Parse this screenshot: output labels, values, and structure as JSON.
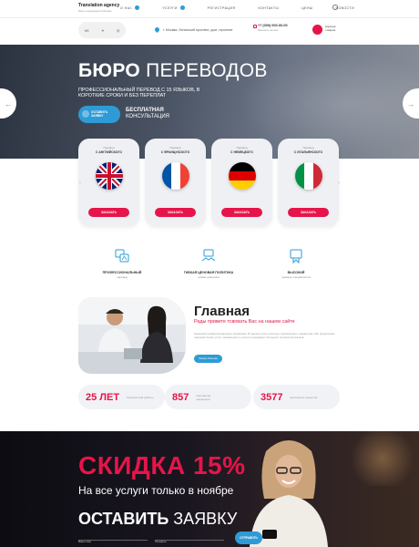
{
  "header": {
    "brand_name": "Translation agency",
    "brand_tagline": "Бюро переводов в Москве",
    "nav": [
      {
        "label": "О НАС",
        "has_dropdown": true
      },
      {
        "label": "УСЛУГИ",
        "has_dropdown": true
      },
      {
        "label": "РЕГИСТРАЦИЯ",
        "has_dropdown": false
      },
      {
        "label": "КОНТАКТЫ",
        "has_dropdown": false
      },
      {
        "label": "ЦЕНЫ",
        "has_dropdown": false
      },
      {
        "label": "НОВОСТИ",
        "has_dropdown": false
      }
    ]
  },
  "contacts": {
    "socials": [
      "vk-icon",
      "telegram-icon",
      "instagram-icon"
    ],
    "social_glyphs": [
      "VK",
      "✈",
      "◎"
    ],
    "address": "г. Москва, Ленинский проспект, дом, строение",
    "phone": "+7 (000) 000-00-00",
    "phone_sub": "Заказать звонок",
    "cart_label": "Корзина товаров"
  },
  "hero": {
    "title_bold": "БЮРО",
    "title_rest": "ПЕРЕВОДОВ",
    "subtitle": "ПРОФЕССИОНАЛЬНЫЙ ПЕРЕВОД С 15 ЯЗЫКОВ, В КОРОТКИЕ СРОКИ И БЕЗ ПЕРЕПЛАТ",
    "button_label": "ОСТАВИТЬ ЗАЯВКУ",
    "free_title": "БЕСПЛАТНАЯ",
    "free_sub": "КОНСУЛЬТАЦИЯ",
    "prev_arrow": "←",
    "next_arrow": "→"
  },
  "languages": {
    "prefix": "Перевод",
    "order_label": "ЗАКАЗАТЬ",
    "items": [
      {
        "label": "С АНГЛИЙСКОГО",
        "flag": "uk-flag-icon"
      },
      {
        "label": "С ФРАНЦУЗСКОГО",
        "flag": "france-flag-icon"
      },
      {
        "label": "С НЕМЕЦКОГО",
        "flag": "germany-flag-icon"
      },
      {
        "label": "С ИТАЛЬЯНСКОГО",
        "flag": "italy-flag-icon"
      }
    ],
    "prev_arrow": "‹",
    "next_arrow": "›"
  },
  "features": [
    {
      "title": "ПРОФЕССИОНАЛЬНЫЙ",
      "desc": "перевод",
      "icon": "translate-icon"
    },
    {
      "title": "ГИБКАЯ ЦЕНОВАЯ ПОЛИТИКА",
      "desc": "низкие расценки",
      "icon": "handshake-icon"
    },
    {
      "title": "ВЫСОКИЙ",
      "desc": "уровень специалистов",
      "icon": "language-badge-icon"
    }
  ],
  "about": {
    "title": "Главная",
    "subtitle": "Рады привете тсвовать Вас на нашем сайте",
    "text": "Компания профессиональных переводов. В нашем штате опытные переводчики и редакторы. Мы предлагаем широкий спектр услуг письменного и устного перевода с большого количества языков.",
    "button_label": "Узнать больше"
  },
  "stats": [
    {
      "number": "25 ЛЕТ",
      "label": "безупречной работы"
    },
    {
      "number": "857",
      "label": "контрактов заключено"
    },
    {
      "number": "3577",
      "label": "выполнено проектов"
    }
  ],
  "promo": {
    "title": "СКИДКА 15%",
    "subtitle": "На все услуги только в ноябре",
    "cta_bold": "ОСТАВИТЬ",
    "cta_rest": "ЗАЯВКУ",
    "name_placeholder": "Ваше имя",
    "phone_placeholder": "Телефон",
    "button_label": "ОТПРАВИТЬ"
  },
  "colors": {
    "accent_red": "#e5154a",
    "accent_blue": "#2e9bd6"
  }
}
